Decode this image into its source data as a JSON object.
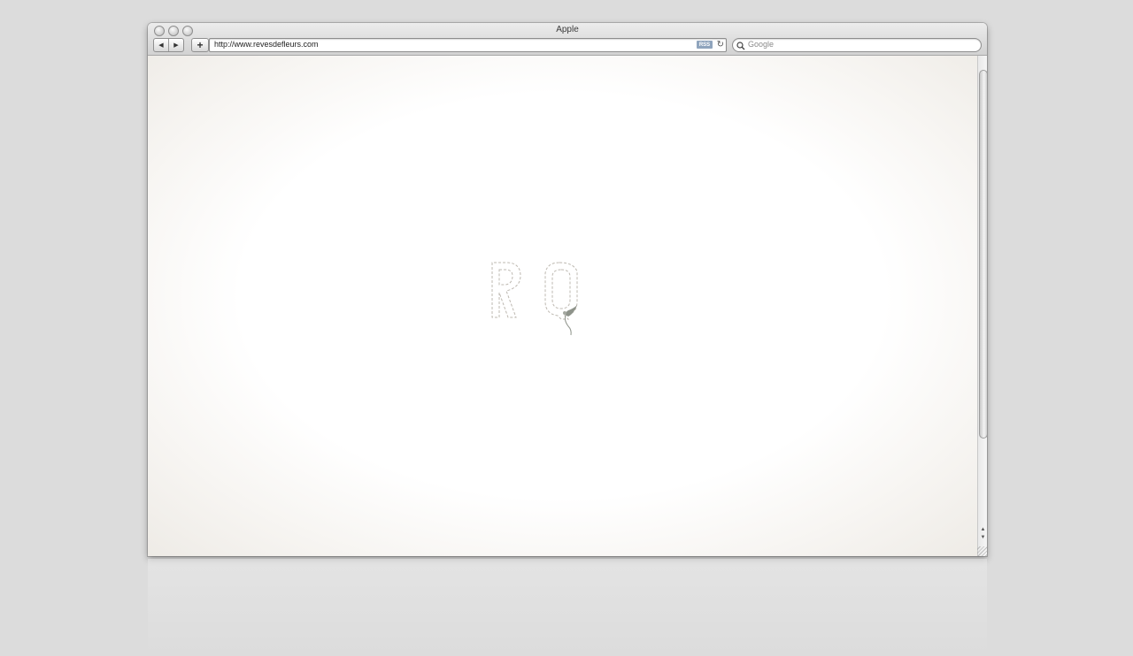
{
  "window": {
    "title": "Apple",
    "traffic_lights": [
      "close",
      "minimize",
      "zoom"
    ]
  },
  "toolbar": {
    "back_icon": "back-arrow-icon",
    "forward_icon": "forward-arrow-icon",
    "back_glyph": "◀",
    "forward_glyph": "▶",
    "add_glyph": "+",
    "url": "http://www.revesdefleurs.com",
    "rss_label": "RSS",
    "reload_glyph": "↻",
    "search_glyph": "🔍",
    "search_placeholder": "Google"
  },
  "page": {
    "logo_letters": "RQ",
    "logo_description_icon": "stitched-monogram-logo"
  },
  "colors": {
    "desktop": "#dcdcdc",
    "stitch": "#bdb8b0",
    "bird": "#8e938a"
  }
}
